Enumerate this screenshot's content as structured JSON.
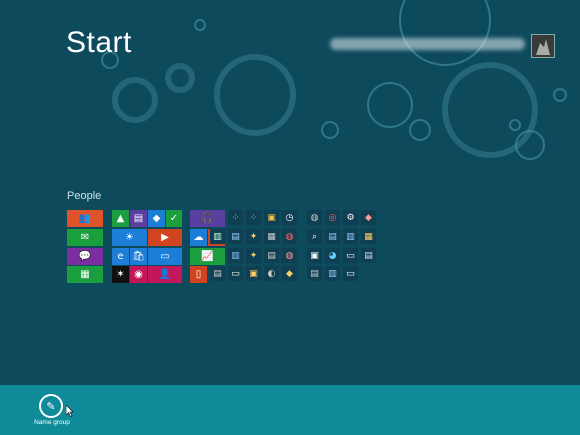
{
  "screen": {
    "title": "Start"
  },
  "user": {
    "name_blurred": "[blurred]",
    "avatar_icon": "user-avatar-icon"
  },
  "group": {
    "label": "People"
  },
  "app_bar": {
    "name_group_label": "Name group",
    "name_group_icon": "pencil-icon"
  },
  "colors": {
    "background": "#0d4a5c",
    "app_bar": "#0f8a98",
    "accent_purple": "#5b3fa0"
  }
}
